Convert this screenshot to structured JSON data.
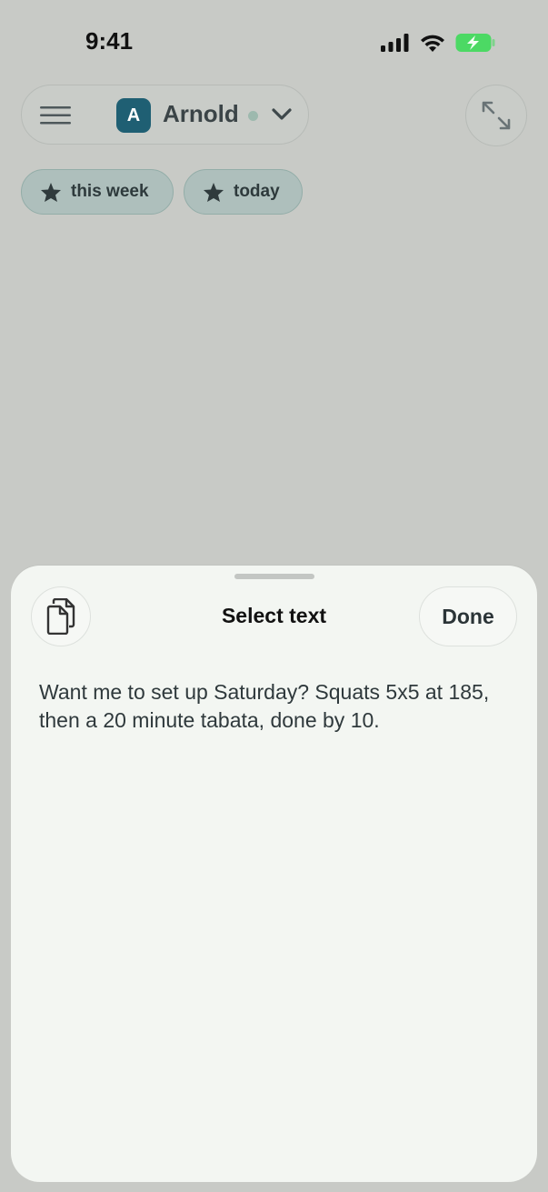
{
  "status_bar": {
    "time": "9:41",
    "icons": [
      "cellular-signal-icon",
      "wifi-icon",
      "battery-charging-icon"
    ]
  },
  "header": {
    "menu_icon": "hamburger-menu-icon",
    "avatar_initial": "A",
    "agent_name": "Arnold",
    "status": "online",
    "dropdown_icon": "chevron-down-icon",
    "expand_icon": "expand-arrows-icon"
  },
  "chips": [
    {
      "label": "this week",
      "icon": "star-icon"
    },
    {
      "label": "today",
      "icon": "star-icon"
    }
  ],
  "sheet": {
    "title": "Select text",
    "done_label": "Done",
    "copy_icon": "copy-icon",
    "text": "Want me to set up Saturday? Squats 5x5 at 185, then a 20 minute tabata, done by 10."
  },
  "colors": {
    "accent": "#1f5f73",
    "background": "#c8cac6",
    "sheet": "#f3f6f2",
    "chip": "#aebfbc",
    "battery": "#4cd964"
  }
}
